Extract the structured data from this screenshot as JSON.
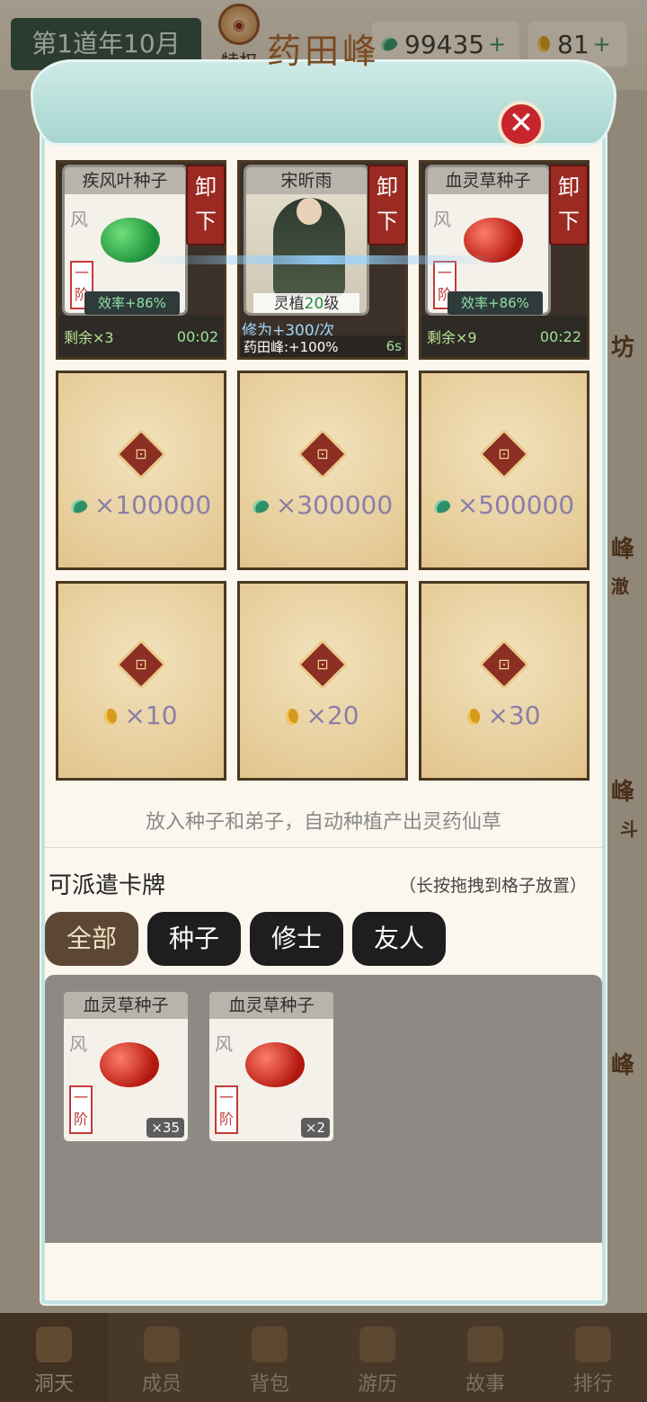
{
  "header": {
    "year": "第1道年10月",
    "vip_label": "特权",
    "jade": "99435",
    "gold": "81",
    "plus": "+"
  },
  "modal": {
    "title": "药田峰",
    "close": "✕"
  },
  "slots_filled": [
    {
      "card_name": "疾风叶种子",
      "element": "风",
      "tier": "一阶",
      "efficiency": "效率+86%",
      "unload": "卸下",
      "remaining": "剩余×3",
      "timer": "00:02"
    },
    {
      "card_name": "宋昕雨",
      "level_prefix": "灵植",
      "level_num": "20",
      "level_suffix": "级",
      "unload": "卸下",
      "xiu": "修为+300/次",
      "peak": "药田峰:+100%",
      "time": "6s"
    },
    {
      "card_name": "血灵草种子",
      "element": "风",
      "tier": "一阶",
      "efficiency": "效率+86%",
      "unload": "卸下",
      "remaining": "剩余×9",
      "timer": "00:22"
    }
  ],
  "locked_jade": [
    "×100000",
    "×300000",
    "×500000"
  ],
  "locked_gold": [
    "×10",
    "×20",
    "×30"
  ],
  "hint": "放入种子和弟子，自动种植产出灵药仙草",
  "dispatch": {
    "title": "可派遣卡牌",
    "note": "（长按拖拽到格子放置）",
    "tabs": [
      "全部",
      "种子",
      "修士",
      "友人"
    ]
  },
  "pool_cards": [
    {
      "name": "血灵草种子",
      "element": "风",
      "tier": "一阶",
      "count": "×35"
    },
    {
      "name": "血灵草种子",
      "element": "风",
      "tier": "一阶",
      "count": "×2"
    }
  ],
  "nav": [
    "洞天",
    "成员",
    "背包",
    "游历",
    "故事",
    "排行"
  ],
  "side": [
    "坊",
    "峰",
    "澈",
    "峰",
    "斗",
    "峰"
  ]
}
